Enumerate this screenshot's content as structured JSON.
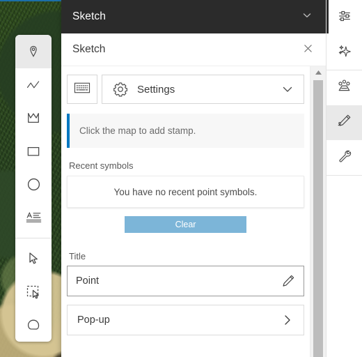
{
  "window": {
    "title": "Sketch",
    "collapse_icon": "chevron-down-icon"
  },
  "panel": {
    "heading": "Sketch",
    "close_icon": "close-icon",
    "toolbar": {
      "keyboard_icon": "keyboard-icon",
      "gear_icon": "gear-icon",
      "settings_label": "Settings",
      "expand_icon": "chevron-down-icon"
    },
    "notice": {
      "message": "Click the map to add stamp.",
      "accent_color": "#0079c1"
    },
    "recent_symbols": {
      "label": "Recent symbols",
      "empty_message": "You have no recent point symbols.",
      "clear_label": "Clear",
      "clear_color": "#7cb5d8"
    },
    "title_field": {
      "label": "Title",
      "value": "Point",
      "edit_icon": "pencil-icon"
    },
    "popup_row": {
      "label": "Pop-up",
      "arrow_icon": "chevron-right-icon"
    },
    "scrollbar": {
      "up_icon": "scroll-up-arrow-icon"
    }
  },
  "sketch_tools": {
    "items": [
      {
        "name": "point-tool",
        "icon": "map-pin-icon",
        "active": true
      },
      {
        "name": "polyline-tool",
        "icon": "polyline-icon",
        "active": false
      },
      {
        "name": "polygon-tool",
        "icon": "polygon-icon",
        "active": false
      },
      {
        "name": "rectangle-tool",
        "icon": "rectangle-icon",
        "active": false
      },
      {
        "name": "circle-tool",
        "icon": "circle-icon",
        "active": false
      },
      {
        "name": "text-tool",
        "icon": "text-icon",
        "active": false
      },
      {
        "name": "select-tool",
        "icon": "cursor-arrow-icon",
        "active": false
      },
      {
        "name": "marquee-select-tool",
        "icon": "marquee-select-icon",
        "active": false
      },
      {
        "name": "lasso-select-tool",
        "icon": "lasso-icon",
        "active": false
      }
    ]
  },
  "right_rail": {
    "items": [
      {
        "name": "rail-item-properties",
        "icon": "sliders-icon",
        "active": false
      },
      {
        "name": "rail-item-effects",
        "icon": "sparkle-icon",
        "active": false
      },
      {
        "name": "rail-item-group",
        "icon": "group-icon",
        "active": false
      },
      {
        "name": "rail-item-sketch",
        "icon": "pencil-icon",
        "active": true
      },
      {
        "name": "rail-item-tools",
        "icon": "wrench-icon",
        "active": false
      }
    ]
  }
}
